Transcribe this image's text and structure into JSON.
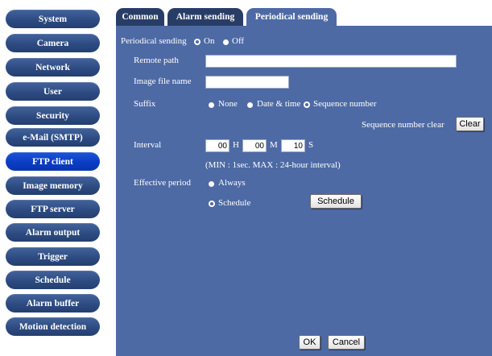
{
  "sidebar": {
    "items": [
      {
        "label": "System"
      },
      {
        "label": "Camera"
      },
      {
        "label": "Network"
      },
      {
        "label": "User"
      },
      {
        "label": "Security"
      },
      {
        "label": "e-Mail (SMTP)"
      },
      {
        "label": "FTP client",
        "active": true
      },
      {
        "label": "Image memory"
      },
      {
        "label": "FTP server"
      },
      {
        "label": "Alarm output"
      },
      {
        "label": "Trigger"
      },
      {
        "label": "Schedule"
      },
      {
        "label": "Alarm buffer"
      },
      {
        "label": "Motion detection"
      }
    ]
  },
  "tabs": [
    {
      "label": "Common"
    },
    {
      "label": "Alarm sending"
    },
    {
      "label": "Periodical sending",
      "active": true
    }
  ],
  "form": {
    "periodical_sending": {
      "label": "Periodical sending",
      "on": "On",
      "off": "Off",
      "selected": "On"
    },
    "remote_path": {
      "label": "Remote path",
      "value": ""
    },
    "image_file_name": {
      "label": "Image file name",
      "value": ""
    },
    "suffix": {
      "label": "Suffix",
      "options": [
        "None",
        "Date & time",
        "Sequence number"
      ],
      "selected": "Sequence number"
    },
    "sequence_clear": {
      "label": "Sequence number clear",
      "button": "Clear"
    },
    "interval": {
      "label": "Interval",
      "hours": "00",
      "h_unit": "H",
      "minutes": "00",
      "m_unit": "M",
      "seconds": "10",
      "s_unit": "S",
      "note": "(MIN : 1sec. MAX : 24-hour interval)"
    },
    "effective_period": {
      "label": "Effective period",
      "always": "Always",
      "schedule": "Schedule",
      "selected": "Schedule",
      "schedule_button": "Schedule"
    }
  },
  "footer": {
    "ok": "OK",
    "cancel": "Cancel"
  },
  "colors": {
    "panel": "#4e6aa4",
    "sidebar_button": "#2c4a80",
    "sidebar_active": "#0a3bc2",
    "tab": "#283d66"
  }
}
